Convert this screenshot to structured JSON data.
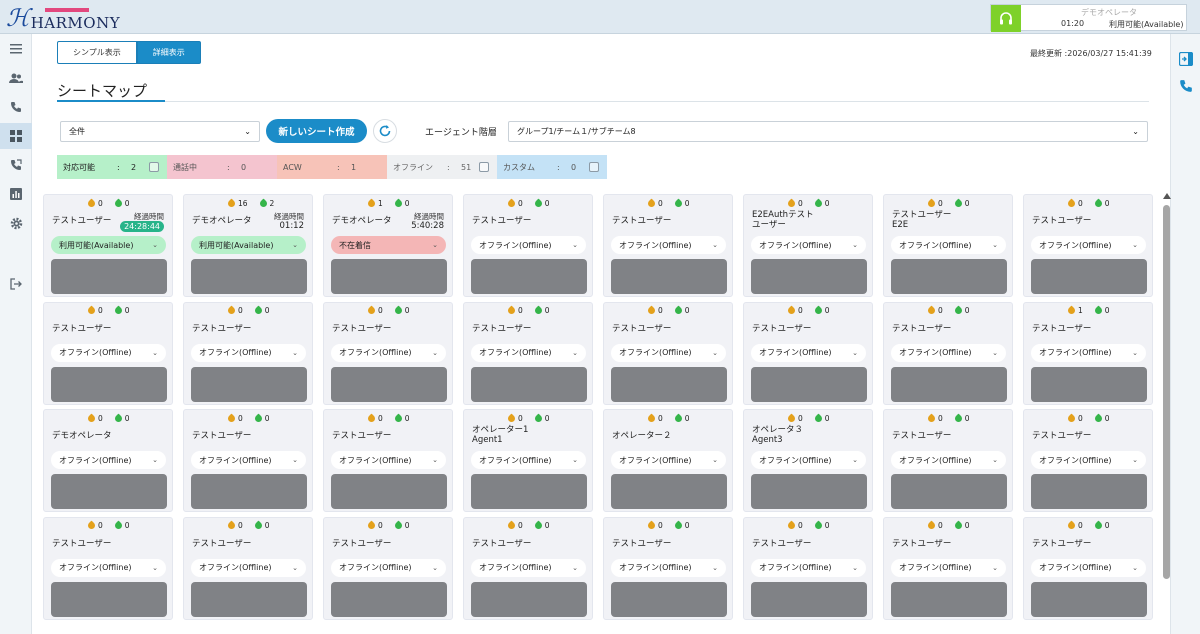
{
  "header": {
    "logo_mark": "ℋ",
    "logo_text": "HARMONY",
    "agent_name": "デモオペレータ",
    "agent_time": "01:20",
    "agent_status": "利用可能(Available)"
  },
  "toolbar": {
    "simple_view": "シンプル表示",
    "detail_view": "詳細表示",
    "last_update": "最終更新 :2026/03/27 15:41:39"
  },
  "page": {
    "title": "シートマップ"
  },
  "controls": {
    "filter_value": "全件",
    "new_button": "新しいシート作成",
    "hierarchy_label": "エージェント階層",
    "hierarchy_value": "グループ1/チーム１/サブチーム8"
  },
  "status_chips": [
    {
      "label": "対応可能",
      "count": "2"
    },
    {
      "label": "通話中",
      "count": "0"
    },
    {
      "label": "ACW",
      "count": "1"
    },
    {
      "label": "オフライン",
      "count": "51"
    },
    {
      "label": "カスタム",
      "count": "0"
    }
  ],
  "colors": {
    "accent": "#1b8cc8",
    "available": "#b6f0c9",
    "talking": "#f4c4cf",
    "acw": "#f7c3b8",
    "custom": "#c4e2f6",
    "screen": "#808286"
  },
  "seats": [
    [
      {
        "in": "0",
        "out": "0",
        "name": "テストユーザー",
        "elapsed_label": "経過時間",
        "elapsed": "24:28:44",
        "elapsed_badge": true,
        "status": "利用可能(Available)",
        "status_type": "available"
      },
      {
        "in": "16",
        "out": "2",
        "name": "デモオペレータ",
        "elapsed_label": "経過時間",
        "elapsed": "01:12",
        "status": "利用可能(Available)",
        "status_type": "available"
      },
      {
        "in": "1",
        "out": "0",
        "name": "デモオペレータ",
        "elapsed_label": "経過時間",
        "elapsed": "5:40:28",
        "status": "不在着信",
        "status_type": "away"
      },
      {
        "in": "0",
        "out": "0",
        "name": "テストユーザー",
        "status": "オフライン(Offline)"
      },
      {
        "in": "0",
        "out": "0",
        "name": "テストユーザー",
        "status": "オフライン(Offline)"
      },
      {
        "in": "0",
        "out": "0",
        "name": "E2EAuthテスト",
        "name2": "ユーザー",
        "status": "オフライン(Offline)"
      },
      {
        "in": "0",
        "out": "0",
        "name": "テストユーザー",
        "name2": "E2E",
        "status": "オフライン(Offline)"
      },
      {
        "in": "0",
        "out": "0",
        "name": "テストユーザー",
        "status": "オフライン(Offline)"
      }
    ],
    [
      {
        "in": "0",
        "out": "0",
        "name": "テストユーザー",
        "status": "オフライン(Offline)"
      },
      {
        "in": "0",
        "out": "0",
        "name": "テストユーザー",
        "status": "オフライン(Offline)"
      },
      {
        "in": "0",
        "out": "0",
        "name": "テストユーザー",
        "status": "オフライン(Offline)"
      },
      {
        "in": "0",
        "out": "0",
        "name": "テストユーザー",
        "status": "オフライン(Offline)"
      },
      {
        "in": "0",
        "out": "0",
        "name": "テストユーザー",
        "status": "オフライン(Offline)"
      },
      {
        "in": "0",
        "out": "0",
        "name": "テストユーザー",
        "status": "オフライン(Offline)"
      },
      {
        "in": "0",
        "out": "0",
        "name": "テストユーザー",
        "status": "オフライン(Offline)"
      },
      {
        "in": "1",
        "out": "0",
        "name": "テストユーザー",
        "status": "オフライン(Offline)"
      }
    ],
    [
      {
        "in": "0",
        "out": "0",
        "name": "デモオペレータ",
        "status": "オフライン(Offline)"
      },
      {
        "in": "0",
        "out": "0",
        "name": "テストユーザー",
        "status": "オフライン(Offline)"
      },
      {
        "in": "0",
        "out": "0",
        "name": "テストユーザー",
        "status": "オフライン(Offline)"
      },
      {
        "in": "0",
        "out": "0",
        "name": "オペレーター1",
        "name2": "Agent1",
        "status": "オフライン(Offline)"
      },
      {
        "in": "0",
        "out": "0",
        "name": "オペレーター２",
        "status": "オフライン(Offline)"
      },
      {
        "in": "0",
        "out": "0",
        "name": "オペレータ３",
        "name2": "Agent3",
        "status": "オフライン(Offline)"
      },
      {
        "in": "0",
        "out": "0",
        "name": "テストユーザー",
        "status": "オフライン(Offline)"
      },
      {
        "in": "0",
        "out": "0",
        "name": "テストユーザー",
        "status": "オフライン(Offline)"
      }
    ],
    [
      {
        "in": "0",
        "out": "0",
        "name": "テストユーザー",
        "status": "オフライン(Offline)"
      },
      {
        "in": "0",
        "out": "0",
        "name": "テストユーザー",
        "status": "オフライン(Offline)"
      },
      {
        "in": "0",
        "out": "0",
        "name": "テストユーザー",
        "status": "オフライン(Offline)"
      },
      {
        "in": "0",
        "out": "0",
        "name": "テストユーザー",
        "status": "オフライン(Offline)"
      },
      {
        "in": "0",
        "out": "0",
        "name": "テストユーザー",
        "status": "オフライン(Offline)"
      },
      {
        "in": "0",
        "out": "0",
        "name": "テストユーザー",
        "status": "オフライン(Offline)"
      },
      {
        "in": "0",
        "out": "0",
        "name": "テストユーザー",
        "status": "オフライン(Offline)"
      },
      {
        "in": "0",
        "out": "0",
        "name": "テストユーザー",
        "status": "オフライン(Offline)"
      }
    ]
  ],
  "icons": {
    "left_nav": [
      "menu-icon",
      "users-icon",
      "phone-call-icon",
      "seat-map-icon",
      "phone-forward-icon",
      "report-chart-icon",
      "settings-gear-icon",
      "logout-icon"
    ],
    "right_nav": [
      "panel-expand-icon",
      "phone-icon"
    ]
  }
}
